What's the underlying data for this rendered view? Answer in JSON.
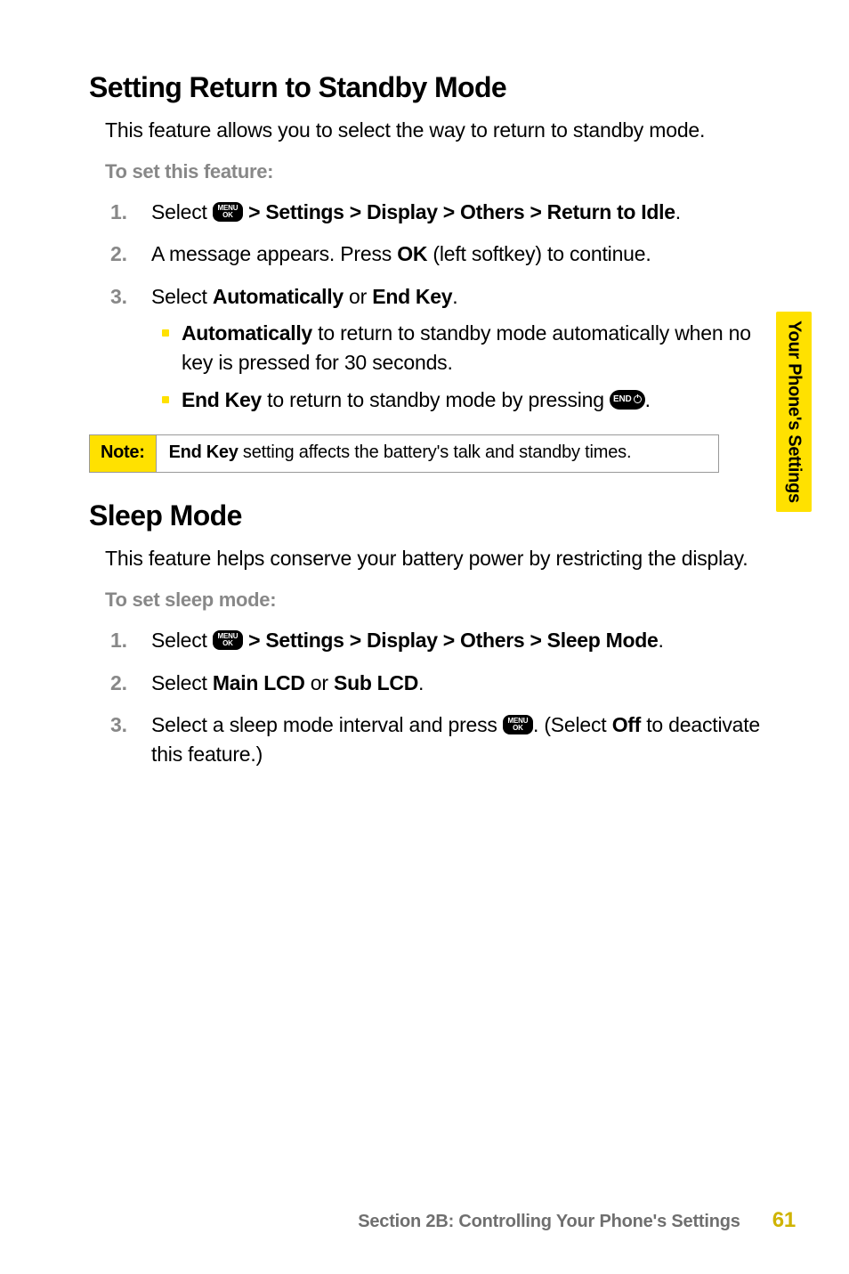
{
  "sideTab": "Your Phone's Settings",
  "sec1": {
    "title": "Setting Return to Standby Mode",
    "intro": "This feature allows you to select the way to return to standby mode.",
    "subhead": "To set this feature:",
    "step1_a": "Select ",
    "step1_b": " > Settings > Display > Others > Return to Idle",
    "step2_a": "A message appears. Press ",
    "step2_b": "OK",
    "step2_c": " (left softkey) to continue.",
    "step3_a": "Select ",
    "step3_b": "Automatically",
    "step3_c": " or ",
    "step3_d": "End Key",
    "bullet1_a": "Automatically",
    "bullet1_b": " to return to standby mode automatically when no key is pressed for 30 seconds.",
    "bullet2_a": "End Key",
    "bullet2_b": " to return to standby mode by pressing "
  },
  "note": {
    "label": "Note:",
    "text_a": "End Key",
    "text_b": " setting affects the battery's talk and standby times."
  },
  "sec2": {
    "title": "Sleep Mode",
    "intro": "This feature helps conserve your battery power by restricting the display.",
    "subhead": "To set sleep mode:",
    "step1_a": "Select ",
    "step1_b": " > Settings > Display > Others > Sleep Mode",
    "step2_a": "Select ",
    "step2_b": "Main LCD",
    "step2_c": " or ",
    "step2_d": "Sub LCD",
    "step3_a": "Select a sleep mode interval and press ",
    "step3_b": ". (Select ",
    "step3_c": "Off",
    "step3_d": " to deactivate this feature.)"
  },
  "footer": {
    "title": "Section 2B: Controlling Your Phone's Settings",
    "page": "61"
  },
  "icons": {
    "menu_top": "MENU",
    "menu_bot": "OK",
    "end": "END"
  }
}
